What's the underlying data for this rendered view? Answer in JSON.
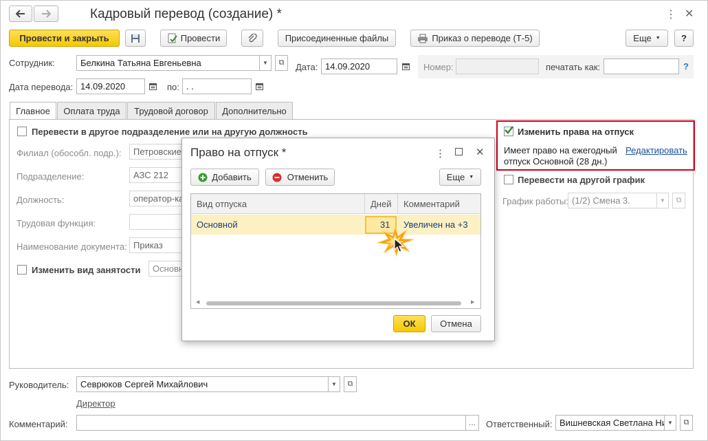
{
  "window": {
    "title": "Кадровый перевод (создание) *"
  },
  "toolbar": {
    "post_close": "Провести и закрыть",
    "post": "Провести",
    "attached_files": "Присоединенные файлы",
    "order_print": "Приказ о переводе (Т-5)",
    "more": "Еще",
    "help": "?"
  },
  "header": {
    "employee_label": "Сотрудник:",
    "employee_value": "Белкина Татьяна Евгеньевна",
    "date_label": "Дата:",
    "date_value": "14.09.2020",
    "number_label": "Номер:",
    "number_value": "",
    "print_as_label": "печатать как:",
    "print_as_value": "",
    "help": "?",
    "transfer_date_label": "Дата перевода:",
    "transfer_date_value": "14.09.2020",
    "to_label": "по:",
    "to_value": " .  ."
  },
  "tabs": [
    {
      "label": "Главное"
    },
    {
      "label": "Оплата труда"
    },
    {
      "label": "Трудовой договор"
    },
    {
      "label": "Дополнительно"
    }
  ],
  "main": {
    "transfer_checkbox_label": "Перевести в другое подразделение или на другую должность",
    "branch_label": "Филиал (обособл. подр.):",
    "branch_value": "Петровские",
    "department_label": "Подразделение:",
    "department_value": "АЗС 212",
    "position_label": "Должность:",
    "position_value": "оператор-ка",
    "function_label": "Трудовая функция:",
    "function_value": "",
    "docname_label": "Наименование документа:",
    "docname_value": "Приказ",
    "employment_checkbox_label": "Изменить вид занятости",
    "employment_value": "Основн"
  },
  "right": {
    "vacation_checkbox_label": "Изменить права на отпуск",
    "vacation_text_line1": "Имеет право на ежегодный",
    "vacation_text_line2": "отпуск Основной (28 дн.)",
    "edit_link": "Редактировать",
    "schedule_checkbox_label": "Перевести на другой график",
    "schedule_label": "График работы:",
    "schedule_value": "(1/2) Смена 3."
  },
  "footer": {
    "manager_label": "Руководитель:",
    "manager_value": "Севрюков Сергей Михайлович",
    "manager_position_link": "Директор",
    "comment_label": "Комментарий:",
    "comment_value": "",
    "responsible_label": "Ответственный:",
    "responsible_value": "Вишневская Светлана Ни"
  },
  "dialog": {
    "title": "Право на отпуск *",
    "add": "Добавить",
    "cancel": "Отменить",
    "more": "Еще",
    "columns": [
      "Вид отпуска",
      "Дней",
      "Комментарий"
    ],
    "rows": [
      {
        "type": "Основной",
        "days": "31",
        "comment": "Увеличен на +3"
      }
    ],
    "ok": "ОК",
    "close_btn": "Отмена"
  },
  "colors": {
    "accent_yellow": "#f5c800",
    "highlight_red": "#d0021b",
    "row_selected": "#fdf0c2",
    "link_blue": "#1a4f9c",
    "green_check": "#3a8a2e"
  }
}
